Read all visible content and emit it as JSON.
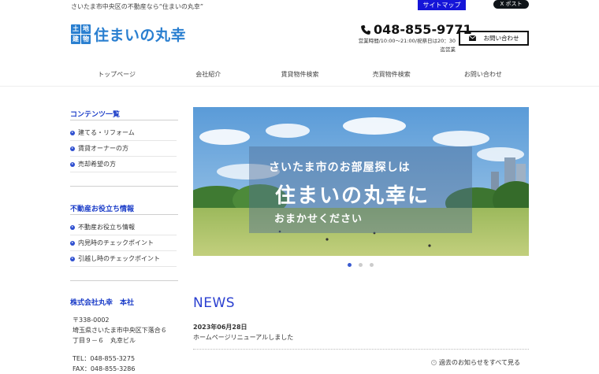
{
  "header": {
    "tagline": "さいたま市中央区の不動産なら“住まいの丸幸”",
    "sitemap_label": "サイトマップ",
    "xpost_label": "X ポスト",
    "logo_badge": [
      "土",
      "地",
      "建",
      "物"
    ],
    "logo_text": "住まいの丸幸",
    "phone": "048-855-9771",
    "hours": "営業時間/10:00～21:00/祝祭日は20：30迄営業",
    "contact_label": "お問い合わせ"
  },
  "nav": {
    "items": [
      "トップページ",
      "会社紹介",
      "賃貸物件検索",
      "売買物件検索",
      "お問い合わせ"
    ]
  },
  "sidebar": {
    "contents_title": "コンテンツ一覧",
    "contents": [
      "建てる・リフォーム",
      "賃貸オーナーの方",
      "売却希望の方"
    ],
    "tips_title": "不動産お役立ち情報",
    "tips": [
      "不動産お役立ち情報",
      "内見時のチェックポイント",
      "引越し時のチェックポイント"
    ],
    "company_name": "株式会社丸幸　本社",
    "postal": "〒338-0002",
    "address1": "埼玉県さいたま市中央区下落合６",
    "address2": "丁目９－６　丸幸ビル",
    "tel": "TEL：048-855-3275",
    "fax": "FAX：048-855-3286"
  },
  "hero": {
    "line1": "さいたま市のお部屋探しは",
    "line2": "住まいの丸幸に",
    "line3": "おまかせください",
    "slide_count": 3,
    "active_slide": 1
  },
  "news": {
    "title": "NEWS",
    "date": "2023年06月28日",
    "text": "ホームページリニューアルしました",
    "more_label": "過去のお知らせをすべて見る"
  },
  "colors": {
    "accent": "#1a3cc8",
    "logo_blue": "#2a7fd0",
    "sitemap_bg": "#1515d8"
  }
}
